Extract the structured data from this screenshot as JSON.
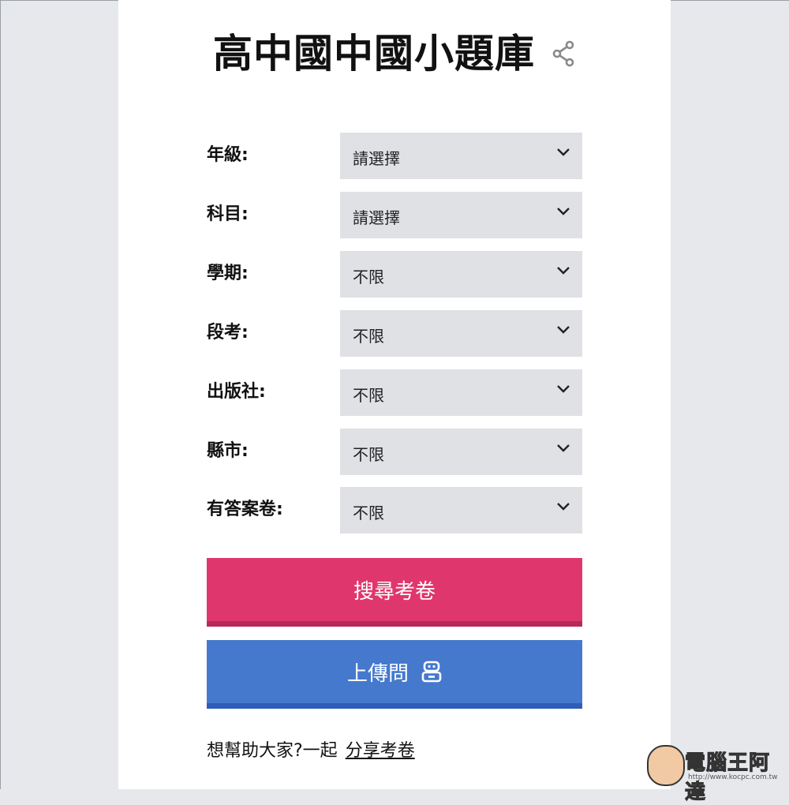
{
  "header": {
    "title": "高中國中國小題庫",
    "share_icon": "share-icon"
  },
  "form": {
    "fields": [
      {
        "label": "年級:",
        "value": "請選擇"
      },
      {
        "label": "科目:",
        "value": "請選擇"
      },
      {
        "label": "學期:",
        "value": "不限"
      },
      {
        "label": "段考:",
        "value": "不限"
      },
      {
        "label": "出版社:",
        "value": "不限"
      },
      {
        "label": "縣市:",
        "value": "不限"
      },
      {
        "label": "有答案卷:",
        "value": "不限"
      }
    ]
  },
  "buttons": {
    "search_label": "搜尋考卷",
    "upload_label": "上傳問",
    "upload_icon": "robot-icon"
  },
  "footer": {
    "text": "想幫助大家?一起",
    "link": "分享考卷"
  },
  "watermark": {
    "text": "電腦王阿達",
    "url": "http://www.kocpc.com.tw"
  },
  "colors": {
    "search": "#df376d",
    "upload": "#4579cd",
    "select_bg": "#dfe1e5",
    "page_bg": "#e6e8ec"
  }
}
